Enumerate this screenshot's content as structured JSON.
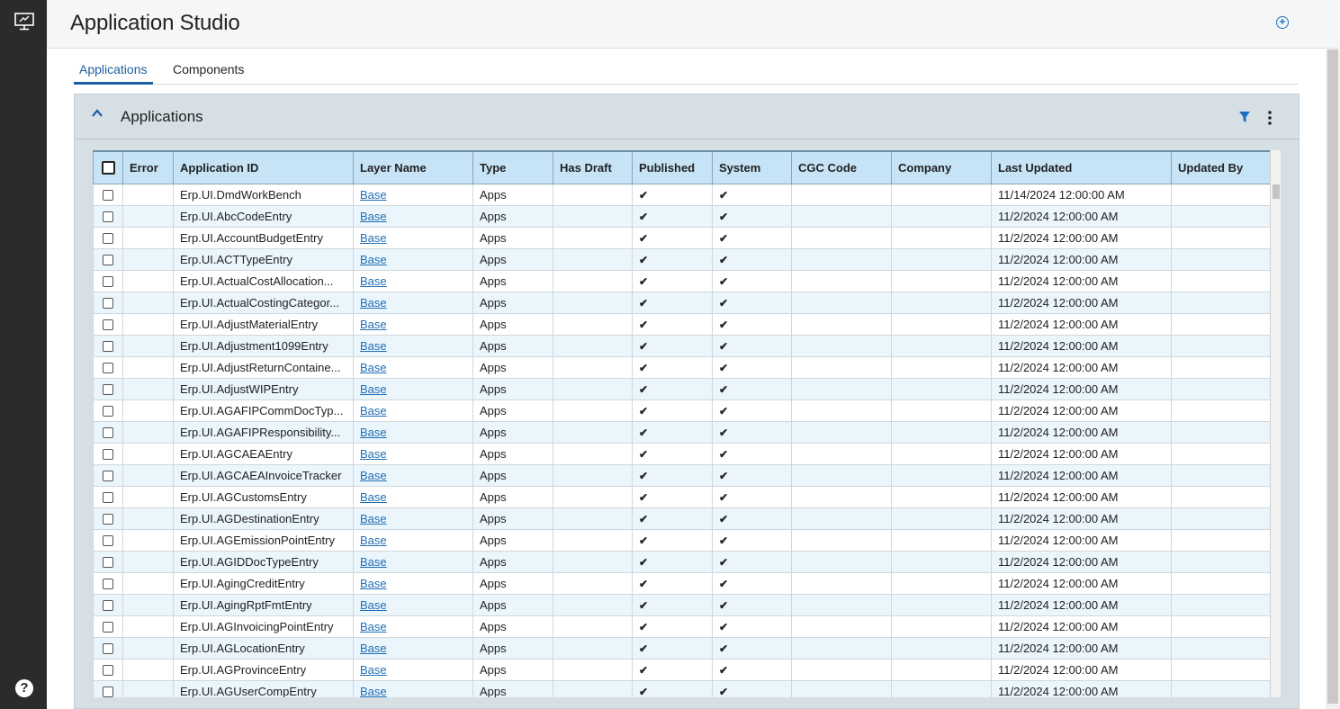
{
  "app": {
    "title": "Application Studio"
  },
  "tabs": [
    {
      "label": "Applications",
      "active": true
    },
    {
      "label": "Components",
      "active": false
    }
  ],
  "panel": {
    "title": "Applications"
  },
  "colors": {
    "accent": "#1b5fa0",
    "header_bg": "#c6e4f6",
    "alt_row": "#eaf5fc",
    "sidebar": "#2b2b2b"
  },
  "icons": {
    "sidebar_top": "monitor-icon",
    "sidebar_bottom": "help-icon",
    "header_action": "add-circle-icon",
    "panel_toggle": "chevron-up-icon",
    "panel_filter": "filter-icon",
    "panel_menu": "kebab-menu-icon"
  },
  "help_glyph": "?",
  "table": {
    "columns": [
      "Error",
      "Application ID",
      "Layer Name",
      "Type",
      "Has Draft",
      "Published",
      "System",
      "CGC Code",
      "Company",
      "Last Updated",
      "Updated By"
    ],
    "check_glyph": "✔",
    "rows": [
      {
        "id": "Erp.UI.DmdWorkBench",
        "layer": "Base",
        "type": "Apps",
        "published": true,
        "system": true,
        "updated": "11/14/2024 12:00:00 AM"
      },
      {
        "id": "Erp.UI.AbcCodeEntry",
        "layer": "Base",
        "type": "Apps",
        "published": true,
        "system": true,
        "updated": "11/2/2024 12:00:00 AM"
      },
      {
        "id": "Erp.UI.AccountBudgetEntry",
        "layer": "Base",
        "type": "Apps",
        "published": true,
        "system": true,
        "updated": "11/2/2024 12:00:00 AM"
      },
      {
        "id": "Erp.UI.ACTTypeEntry",
        "layer": "Base",
        "type": "Apps",
        "published": true,
        "system": true,
        "updated": "11/2/2024 12:00:00 AM"
      },
      {
        "id": "Erp.UI.ActualCostAllocation...",
        "layer": "Base",
        "type": "Apps",
        "published": true,
        "system": true,
        "updated": "11/2/2024 12:00:00 AM"
      },
      {
        "id": "Erp.UI.ActualCostingCategor...",
        "layer": "Base",
        "type": "Apps",
        "published": true,
        "system": true,
        "updated": "11/2/2024 12:00:00 AM"
      },
      {
        "id": "Erp.UI.AdjustMaterialEntry",
        "layer": "Base",
        "type": "Apps",
        "published": true,
        "system": true,
        "updated": "11/2/2024 12:00:00 AM"
      },
      {
        "id": "Erp.UI.Adjustment1099Entry",
        "layer": "Base",
        "type": "Apps",
        "published": true,
        "system": true,
        "updated": "11/2/2024 12:00:00 AM"
      },
      {
        "id": "Erp.UI.AdjustReturnContaine...",
        "layer": "Base",
        "type": "Apps",
        "published": true,
        "system": true,
        "updated": "11/2/2024 12:00:00 AM"
      },
      {
        "id": "Erp.UI.AdjustWIPEntry",
        "layer": "Base",
        "type": "Apps",
        "published": true,
        "system": true,
        "updated": "11/2/2024 12:00:00 AM"
      },
      {
        "id": "Erp.UI.AGAFIPCommDocTyp...",
        "layer": "Base",
        "type": "Apps",
        "published": true,
        "system": true,
        "updated": "11/2/2024 12:00:00 AM"
      },
      {
        "id": "Erp.UI.AGAFIPResponsibility...",
        "layer": "Base",
        "type": "Apps",
        "published": true,
        "system": true,
        "updated": "11/2/2024 12:00:00 AM"
      },
      {
        "id": "Erp.UI.AGCAEAEntry",
        "layer": "Base",
        "type": "Apps",
        "published": true,
        "system": true,
        "updated": "11/2/2024 12:00:00 AM"
      },
      {
        "id": "Erp.UI.AGCAEAInvoiceTracker",
        "layer": "Base",
        "type": "Apps",
        "published": true,
        "system": true,
        "updated": "11/2/2024 12:00:00 AM"
      },
      {
        "id": "Erp.UI.AGCustomsEntry",
        "layer": "Base",
        "type": "Apps",
        "published": true,
        "system": true,
        "updated": "11/2/2024 12:00:00 AM"
      },
      {
        "id": "Erp.UI.AGDestinationEntry",
        "layer": "Base",
        "type": "Apps",
        "published": true,
        "system": true,
        "updated": "11/2/2024 12:00:00 AM"
      },
      {
        "id": "Erp.UI.AGEmissionPointEntry",
        "layer": "Base",
        "type": "Apps",
        "published": true,
        "system": true,
        "updated": "11/2/2024 12:00:00 AM"
      },
      {
        "id": "Erp.UI.AGIDDocTypeEntry",
        "layer": "Base",
        "type": "Apps",
        "published": true,
        "system": true,
        "updated": "11/2/2024 12:00:00 AM"
      },
      {
        "id": "Erp.UI.AgingCreditEntry",
        "layer": "Base",
        "type": "Apps",
        "published": true,
        "system": true,
        "updated": "11/2/2024 12:00:00 AM"
      },
      {
        "id": "Erp.UI.AgingRptFmtEntry",
        "layer": "Base",
        "type": "Apps",
        "published": true,
        "system": true,
        "updated": "11/2/2024 12:00:00 AM"
      },
      {
        "id": "Erp.UI.AGInvoicingPointEntry",
        "layer": "Base",
        "type": "Apps",
        "published": true,
        "system": true,
        "updated": "11/2/2024 12:00:00 AM"
      },
      {
        "id": "Erp.UI.AGLocationEntry",
        "layer": "Base",
        "type": "Apps",
        "published": true,
        "system": true,
        "updated": "11/2/2024 12:00:00 AM"
      },
      {
        "id": "Erp.UI.AGProvinceEntry",
        "layer": "Base",
        "type": "Apps",
        "published": true,
        "system": true,
        "updated": "11/2/2024 12:00:00 AM"
      },
      {
        "id": "Erp.UI.AGUserCompEntry",
        "layer": "Base",
        "type": "Apps",
        "published": true,
        "system": true,
        "updated": "11/2/2024 12:00:00 AM"
      }
    ]
  }
}
